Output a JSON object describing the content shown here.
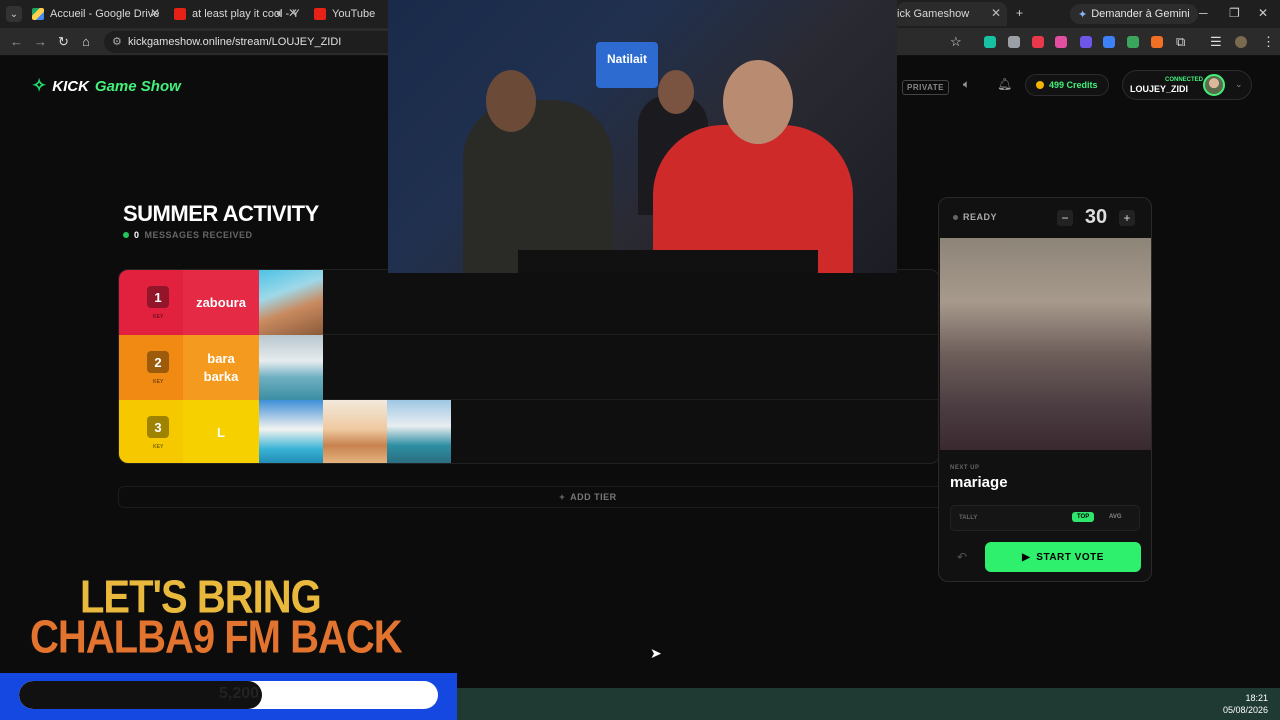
{
  "browser": {
    "tabs": [
      {
        "title": "Accueil - Google Drive",
        "active": false
      },
      {
        "title": "at least play it cool - Y",
        "active": false
      },
      {
        "title": "YouTube",
        "active": false
      },
      {
        "title": "ick Gameshow",
        "active": true
      }
    ],
    "gemini_label": "Demander à Gemini",
    "url": "kickgameshow.online/stream/LOUJEY_ZIDI"
  },
  "header": {
    "logo_kick": "KICK",
    "logo_gameshow": "Game Show",
    "private_badge": "PRIVATE",
    "credits": "499 Credits",
    "user_status": "CONNECTED",
    "username": "LOUJEY_ZIDI"
  },
  "board": {
    "title": "SUMMER ACTIVITY",
    "messages_count": "0",
    "messages_label": "MESSAGES RECEIVED",
    "tiers": [
      {
        "number": "1",
        "key": "KEY",
        "label": "zaboura",
        "color": "#e2213f",
        "label_color": "#e42a45"
      },
      {
        "number": "2",
        "key": "KEY",
        "label": "bara barka",
        "color": "#f08a12",
        "label_color": "#f39a1f"
      },
      {
        "number": "3",
        "key": "KEY",
        "label": "L",
        "color": "#f5c800",
        "label_color": "#f7d000"
      }
    ],
    "add_tier": "ADD TIER"
  },
  "panel": {
    "status": "READY",
    "timer": "30",
    "next_up_label": "NEXT UP",
    "next_up_name": "mariage",
    "tally_label": "TALLY",
    "tally_top": "TOP",
    "tally_avg": "AVG",
    "start_vote": "START VOTE"
  },
  "camera": {
    "sign_text": "Natilait"
  },
  "overlay": {
    "promo_line1": "LET'S BRING",
    "promo_line2": "CHALBA9 FM BACK",
    "goal_text": "5,200",
    "goal_progress": 0.58
  },
  "system": {
    "time": "18:21",
    "date": "05/08/2026"
  },
  "colors": {
    "accent": "#2ef06c",
    "brand_green": "#43f07b"
  }
}
